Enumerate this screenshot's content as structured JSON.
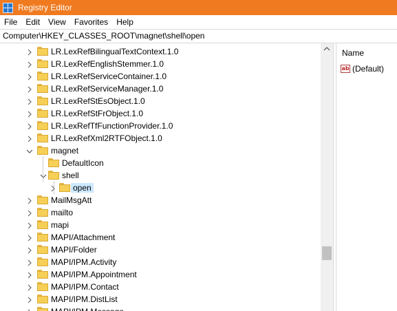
{
  "window": {
    "title": "Registry Editor",
    "titlebar_color": "#f07a1f"
  },
  "menu": [
    "File",
    "Edit",
    "View",
    "Favorites",
    "Help"
  ],
  "address": "Computer\\HKEY_CLASSES_ROOT\\magnet\\shell\\open",
  "tree": {
    "items": [
      {
        "label": "LR.LexRefBilingualTextContext.1.0",
        "depth": 0,
        "expander": "collapsed"
      },
      {
        "label": "LR.LexRefEnglishStemmer.1.0",
        "depth": 0,
        "expander": "collapsed"
      },
      {
        "label": "LR.LexRefServiceContainer.1.0",
        "depth": 0,
        "expander": "collapsed"
      },
      {
        "label": "LR.LexRefServiceManager.1.0",
        "depth": 0,
        "expander": "collapsed"
      },
      {
        "label": "LR.LexRefStEsObject.1.0",
        "depth": 0,
        "expander": "collapsed"
      },
      {
        "label": "LR.LexRefStFrObject.1.0",
        "depth": 0,
        "expander": "collapsed"
      },
      {
        "label": "LR.LexRefTfFunctionProvider.1.0",
        "depth": 0,
        "expander": "collapsed"
      },
      {
        "label": "LR.LexRefXml2RTFObject.1.0",
        "depth": 0,
        "expander": "collapsed"
      },
      {
        "label": "magnet",
        "depth": 0,
        "expander": "expanded"
      },
      {
        "label": "DefaultIcon",
        "depth": 1,
        "expander": "none"
      },
      {
        "label": "shell",
        "depth": 1,
        "expander": "expanded"
      },
      {
        "label": "open",
        "depth": 2,
        "expander": "collapsed",
        "selected": true
      },
      {
        "label": "MailMsgAtt",
        "depth": 0,
        "expander": "collapsed"
      },
      {
        "label": "mailto",
        "depth": 0,
        "expander": "collapsed"
      },
      {
        "label": "mapi",
        "depth": 0,
        "expander": "collapsed"
      },
      {
        "label": "MAPI/Attachment",
        "depth": 0,
        "expander": "collapsed"
      },
      {
        "label": "MAPI/Folder",
        "depth": 0,
        "expander": "collapsed"
      },
      {
        "label": "MAPI/IPM.Activity",
        "depth": 0,
        "expander": "collapsed"
      },
      {
        "label": "MAPI/IPM.Appointment",
        "depth": 0,
        "expander": "collapsed"
      },
      {
        "label": "MAPI/IPM.Contact",
        "depth": 0,
        "expander": "collapsed"
      },
      {
        "label": "MAPI/IPM.DistList",
        "depth": 0,
        "expander": "collapsed"
      },
      {
        "label": "MAPI/IPM.Message",
        "depth": 0,
        "expander": "collapsed"
      }
    ],
    "selection_color": "#cce8ff"
  },
  "list": {
    "column_name": "Name",
    "values": [
      {
        "name": "(Default)",
        "icon": "string-value-icon"
      }
    ]
  }
}
